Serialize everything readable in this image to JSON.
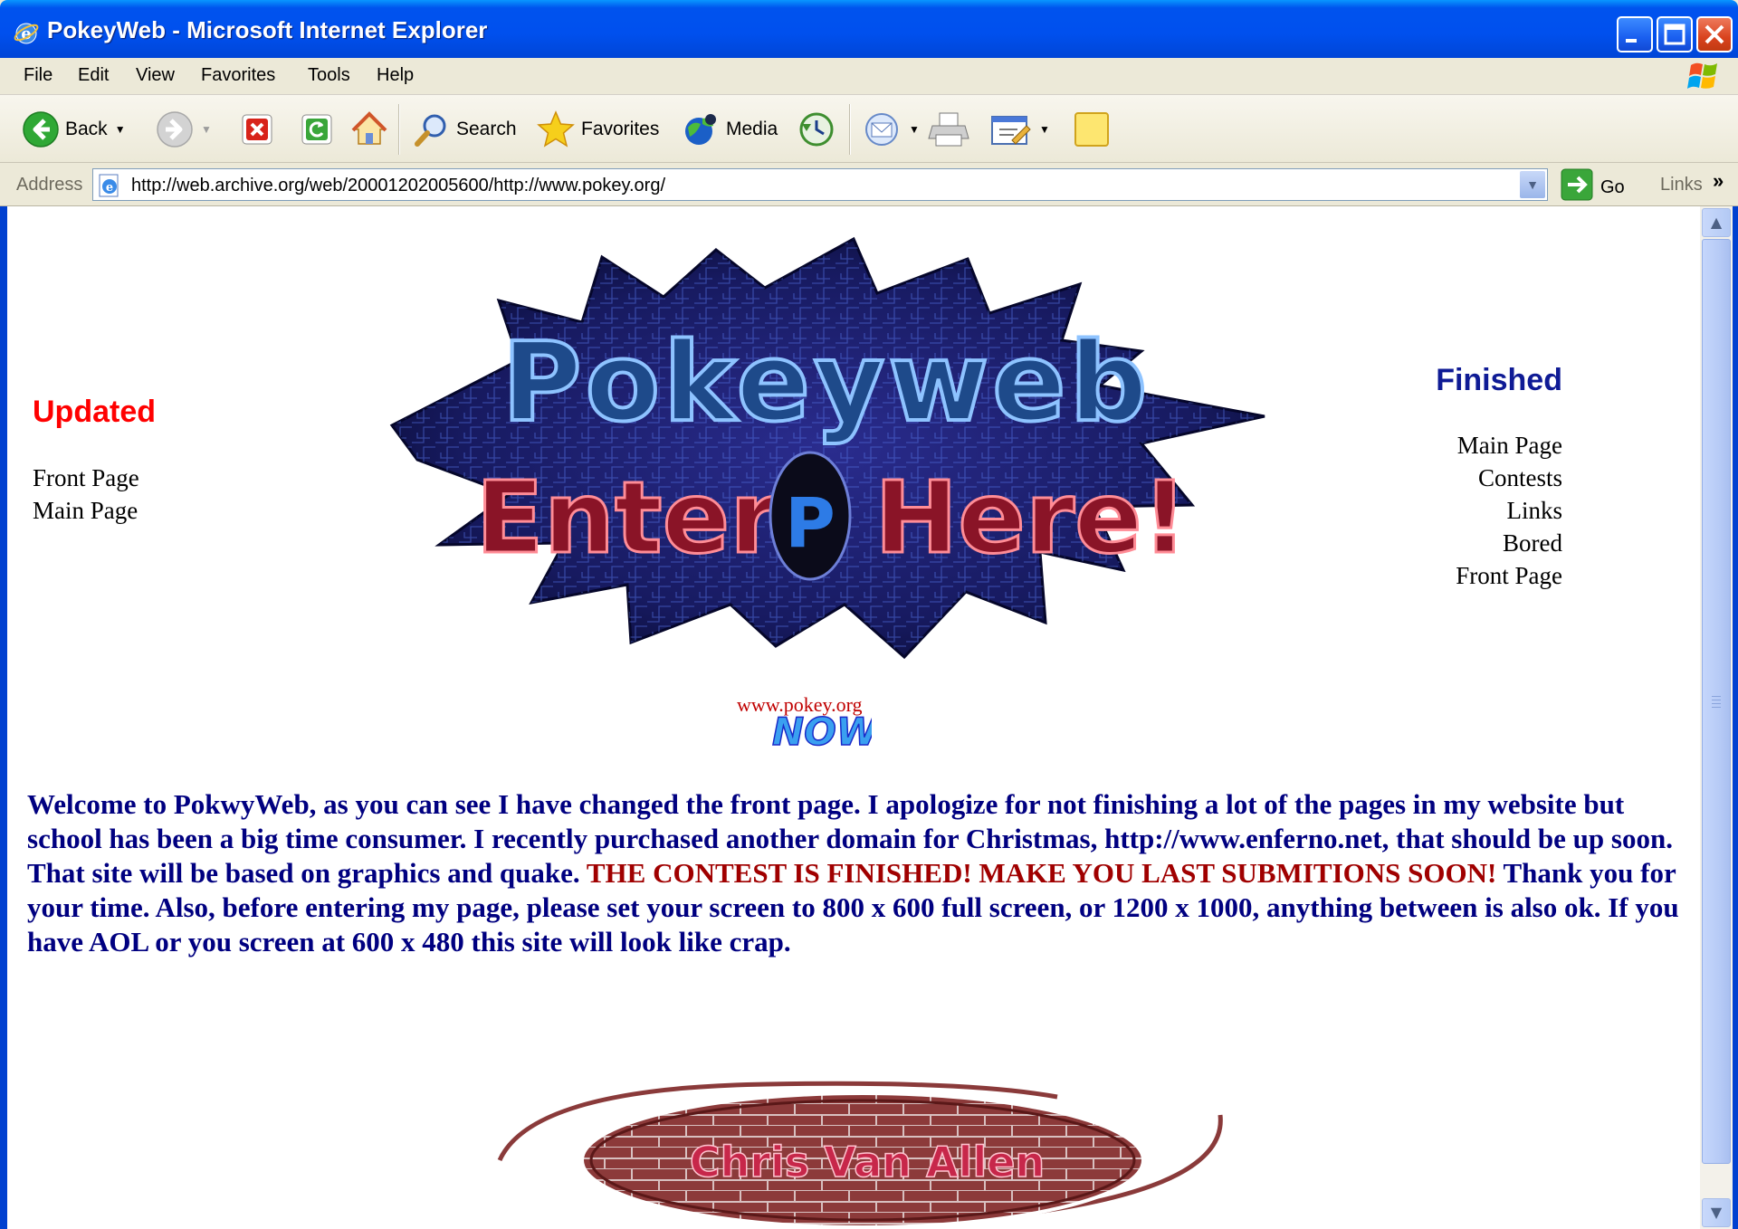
{
  "window": {
    "title": "PokeyWeb - Microsoft Internet Explorer"
  },
  "menu": {
    "items": [
      "File",
      "Edit",
      "View",
      "Favorites",
      "Tools",
      "Help"
    ]
  },
  "toolbar": {
    "back": "Back",
    "search": "Search",
    "favorites": "Favorites",
    "media": "Media"
  },
  "address": {
    "label": "Address",
    "url": "http://web.archive.org/web/20001202005600/http://www.pokey.org/",
    "go": "Go",
    "links": "Links"
  },
  "page": {
    "updated_heading": "Updated",
    "updated_links": [
      "Front Page",
      "Main Page"
    ],
    "finished_heading": "Finished",
    "finished_links": [
      "Main Page",
      "Contests",
      "Links",
      "Bored",
      "Front Page"
    ],
    "logo_text_top": "Pokeyweb",
    "logo_text_bottom_left": "Enter",
    "logo_text_bottom_right": "Here!",
    "logo_badge": "P",
    "site_url": "www.pokey.org",
    "now_text": "NOW",
    "welcome_part1": "Welcome to PokwyWeb, as you can see I have changed the front page. I apologize for not finishing a lot of the pages in my website but school has been a big time consumer. I recently purchased another domain for Christmas, http://www.enferno.net, that should be up soon. That site will be based on graphics and quake. ",
    "welcome_red": "THE CONTEST IS FINISHED! MAKE YOU LAST SUBMITIONS SOON!",
    "welcome_part2": " Thank you for your time. Also, before entering my page, please set your screen to 800 x 600 full screen, or 1200 x 1000, anything between is also ok. If you have AOL or you screen at 600 x 480 this site will look like crap.",
    "footer_name": "Chris Van Allen"
  },
  "colors": {
    "updated": "#ff0000",
    "finished": "#0f1b95",
    "welcome": "#000080",
    "welcome_red": "#a00000",
    "title_bar": "#0050ee"
  },
  "icons": [
    "ie-icon",
    "minimize-icon",
    "maximize-icon",
    "close-icon",
    "windows-flag-icon",
    "back-arrow-icon",
    "forward-arrow-icon",
    "stop-icon",
    "refresh-icon",
    "home-icon",
    "search-icon",
    "favorites-star-icon",
    "media-icon",
    "history-icon",
    "mail-icon",
    "print-icon",
    "edit-icon",
    "messenger-icon",
    "page-icon",
    "go-arrow-icon"
  ]
}
